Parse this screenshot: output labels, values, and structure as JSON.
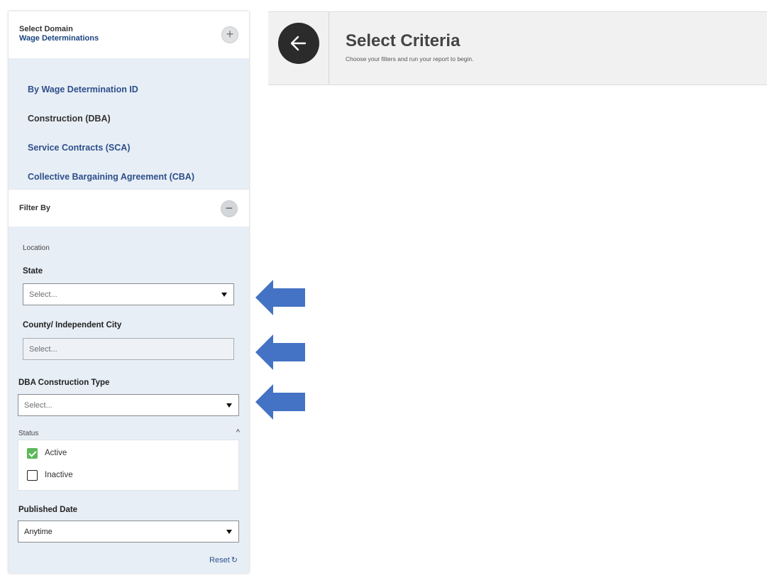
{
  "sidebar": {
    "domain_label": "Select Domain",
    "domain_value": "Wage Determinations",
    "domain_toggle": "+",
    "items": [
      {
        "label": "By Wage Determination ID"
      },
      {
        "label": "Construction (DBA)"
      },
      {
        "label": "Service Contracts (SCA)"
      },
      {
        "label": "Collective Bargaining Agreement (CBA)"
      }
    ],
    "filter_label": "Filter By",
    "filter_toggle": "−",
    "location_label": "Location",
    "state": {
      "label": "State",
      "placeholder": "Select..."
    },
    "county": {
      "label": "County/ Independent City",
      "placeholder": "Select..."
    },
    "construction_type": {
      "label": "DBA Construction Type",
      "placeholder": "Select..."
    },
    "status": {
      "label": "Status",
      "chevron": "^",
      "options": [
        {
          "label": "Active",
          "checked": true
        },
        {
          "label": "Inactive",
          "checked": false
        }
      ]
    },
    "published_date": {
      "label": "Published Date",
      "value": "Anytime"
    },
    "reset_label": "Reset"
  },
  "header": {
    "title": "Select Criteria",
    "subtitle": "Choose your filters and run your report to begin."
  },
  "colors": {
    "sidebar_panel": "#e7eef6",
    "link_blue": "#2e4f8a",
    "annotation_arrow": "#4472c4",
    "checkbox_green": "#5cb85c"
  }
}
